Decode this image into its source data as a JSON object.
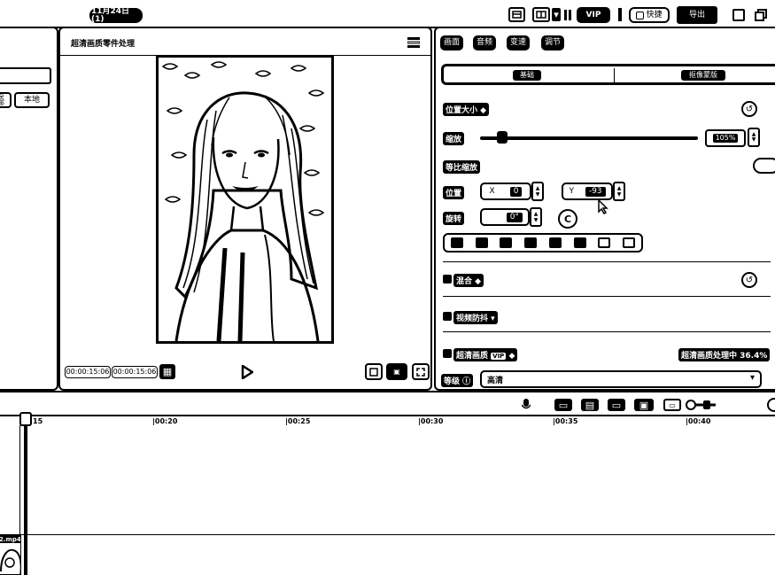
{
  "topbar": {
    "title": "11月24日 (1)",
    "vip_label": "VIP",
    "shortcut_label": "快捷",
    "export_label": "导出",
    "icons": [
      "layout-icon",
      "layout-split-icon",
      "pause-icon",
      "shortcut-icon",
      "minimize-icon",
      "restore-icon"
    ]
  },
  "left": {
    "buttons": [
      "全部",
      "本地"
    ]
  },
  "player": {
    "title": "超清画质零件处理",
    "time_current": "00:00:15:06",
    "time_total": "00:00:15:06",
    "controls": [
      "play-icon",
      "ratio-icon",
      "fullscreen-icon"
    ]
  },
  "props": {
    "tabs": [
      "画面",
      "音频",
      "变速",
      "调节"
    ],
    "subtabs": [
      "基础",
      "抠像蒙版"
    ],
    "section_transform": "位置大小",
    "scale_label": "缩放",
    "scale_value": "105%",
    "scale_fraction": 0.1,
    "uniform_label": "等比缩放",
    "position_label": "位置",
    "pos_x_prefix": "X",
    "pos_x": "0",
    "pos_y_prefix": "Y",
    "pos_y": "-93",
    "rotate_label": "旋转",
    "rotate_value": "0°",
    "blend_label": "混合",
    "stabilize_label": "视频防抖",
    "hd_label": "超清画质",
    "hd_badge": "VIP",
    "hd_status": "超清画质处理中 36.4%",
    "level_label": "等级",
    "level_value": "高清"
  },
  "timeline": {
    "ticks": [
      "|00:20",
      "|00:25",
      "|00:30",
      "|00:35",
      "|00:40"
    ],
    "playhead_label": "15",
    "clip_name": "2.mp4"
  }
}
